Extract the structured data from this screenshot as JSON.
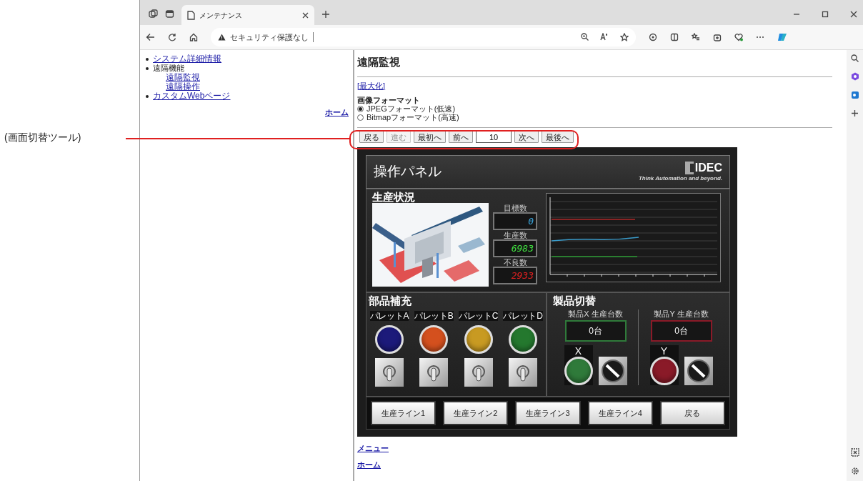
{
  "annotation": {
    "label": "(画面切替ツール)"
  },
  "browser": {
    "tab_title": "メンテナンス",
    "security": "セキュリティ保護なし"
  },
  "menu": {
    "items": [
      {
        "label": "システム詳細情報",
        "kind": "link"
      },
      {
        "label": "遠隔機能",
        "kind": "heading",
        "children": [
          {
            "label": "遠隔監視"
          },
          {
            "label": "遠隔操作"
          }
        ]
      },
      {
        "label": "カスタムWebページ",
        "kind": "link"
      }
    ],
    "home_link": "ホーム"
  },
  "page": {
    "title": "遠隔監視",
    "maximize_link": "[最大化]",
    "format": {
      "label": "画像フォーマット",
      "options": [
        {
          "label": "JPEGフォーマット(低速)",
          "selected": true
        },
        {
          "label": "Bitmapフォーマット(高速)",
          "selected": false
        }
      ]
    },
    "toolbar": [
      {
        "kind": "button",
        "label": "戻る",
        "disabled": false
      },
      {
        "kind": "button",
        "label": "進む",
        "disabled": true
      },
      {
        "kind": "button",
        "label": "最初へ",
        "disabled": false
      },
      {
        "kind": "button",
        "label": "前へ",
        "disabled": false
      },
      {
        "kind": "field",
        "value": "10"
      },
      {
        "kind": "button",
        "label": "次へ",
        "disabled": false
      },
      {
        "kind": "button",
        "label": "最後へ",
        "disabled": false
      }
    ],
    "footer_links": [
      "メニュー",
      "ホーム"
    ]
  },
  "panel": {
    "title": "操作パネル",
    "logo": {
      "text": "IDEC",
      "tagline": "Think Automation and beyond."
    },
    "production": {
      "title": "生産状況",
      "counters": [
        {
          "label": "目標数",
          "value": "0",
          "color": "#3aa8e0"
        },
        {
          "label": "生産数",
          "value": "6983",
          "color": "#40e040"
        },
        {
          "label": "不良数",
          "value": "2933",
          "color": "#e02020"
        }
      ]
    },
    "parts": {
      "title": "部品補充",
      "pallets": [
        {
          "label": "パレットA",
          "color": "#1c1a7a",
          "on": false
        },
        {
          "label": "パレットB",
          "color": "#d4501e",
          "on": false
        },
        {
          "label": "パレットC",
          "color": "#c89a22",
          "on": false
        },
        {
          "label": "パレットD",
          "color": "#24782e",
          "on": false
        }
      ]
    },
    "switching": {
      "title": "製品切替",
      "products": [
        {
          "count_label": "製品X 生産台数",
          "count": "0台",
          "lamp_label": "X",
          "color": "#2f7a3a",
          "on": false
        },
        {
          "count_label": "製品Y 生産台数",
          "count": "0台",
          "lamp_label": "Y",
          "color": "#8a1a28",
          "on": false
        }
      ]
    },
    "line_buttons": [
      "生産ライン1",
      "生産ライン2",
      "生産ライン3",
      "生産ライン4",
      "戻る"
    ]
  }
}
